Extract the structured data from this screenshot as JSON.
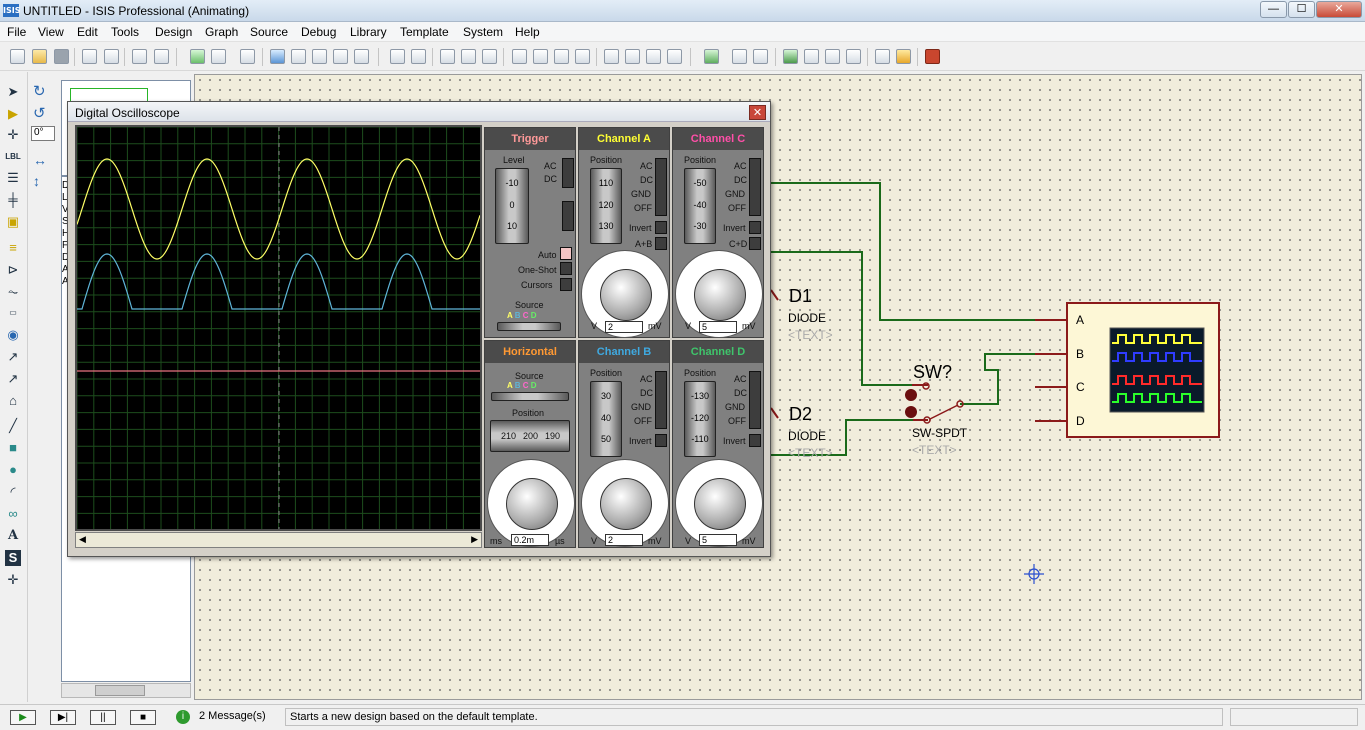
{
  "app": {
    "title": "UNTITLED - ISIS Professional (Animating)",
    "icon": "ISIS"
  },
  "window_controls": {
    "minimize": "—",
    "maximize": "☐",
    "close": "✕"
  },
  "menu": [
    "File",
    "View",
    "Edit",
    "Tools",
    "Design",
    "Graph",
    "Source",
    "Debug",
    "Library",
    "Template",
    "System",
    "Help"
  ],
  "left_panel": {
    "rotation": "0°",
    "list_letters": [
      "D",
      "L",
      "V",
      "S",
      "H",
      "F",
      "D",
      "A",
      "A"
    ]
  },
  "scope": {
    "title": "Digital Oscilloscope",
    "trigger": {
      "header": "Trigger",
      "level_label": "Level",
      "scale": [
        "-10",
        "0",
        "10"
      ],
      "coupling": [
        "AC",
        "DC"
      ],
      "modes": [
        "Auto",
        "One-Shot",
        "Cursors"
      ],
      "source_label": "Source",
      "sources": [
        "A",
        "B",
        "C",
        "D"
      ]
    },
    "channel_a": {
      "header": "Channel A",
      "position_label": "Position",
      "scale": [
        "110",
        "120",
        "130"
      ],
      "coupling": [
        "AC",
        "DC",
        "GND",
        "OFF"
      ],
      "invert": "Invert",
      "combine": "A+B",
      "knob_value": "2",
      "unit_left": "V",
      "unit_right": "mV",
      "knob_ticks": [
        "0.1",
        "0.2",
        "0.5",
        "1",
        "2",
        "5",
        "10",
        "20",
        "50"
      ]
    },
    "channel_c": {
      "header": "Channel C",
      "position_label": "Position",
      "scale": [
        "-50",
        "-40",
        "-30"
      ],
      "coupling": [
        "AC",
        "DC",
        "GND",
        "OFF"
      ],
      "invert": "Invert",
      "combine": "C+D",
      "knob_value": "5",
      "unit_left": "V",
      "unit_right": "mV"
    },
    "horizontal": {
      "header": "Horizontal",
      "source_label": "Source",
      "sources": [
        "A",
        "B",
        "C",
        "D"
      ],
      "position_label": "Position",
      "scale": [
        "210",
        "200",
        "190"
      ],
      "knob_value": "0.2m",
      "unit_left": "ms",
      "unit_right": "µs"
    },
    "channel_b": {
      "header": "Channel B",
      "position_label": "Position",
      "scale": [
        "30",
        "40",
        "50"
      ],
      "coupling": [
        "AC",
        "DC",
        "GND",
        "OFF"
      ],
      "invert": "Invert",
      "knob_value": "2",
      "unit_left": "V",
      "unit_right": "mV"
    },
    "channel_d": {
      "header": "Channel D",
      "position_label": "Position",
      "scale": [
        "-130",
        "-120",
        "-110"
      ],
      "coupling": [
        "AC",
        "DC",
        "GND",
        "OFF"
      ],
      "invert": "Invert",
      "knob_value": "5",
      "unit_left": "V",
      "unit_right": "mV"
    },
    "colors": {
      "trace_a": "#ffff66",
      "trace_b": "#5fb5d8",
      "trace_c": "#e8737f",
      "grid": "#1d4d1d"
    }
  },
  "schematic": {
    "d1": {
      "ref": "D1",
      "type": "DIODE",
      "text": "<TEXT>"
    },
    "d2": {
      "ref": "D2",
      "type": "DIODE",
      "text": "<TEXT>"
    },
    "sw": {
      "ref": "SW?",
      "type": "SW-SPDT",
      "text": "<TEXT>"
    },
    "scope_pins": [
      "A",
      "B",
      "C",
      "D"
    ]
  },
  "status": {
    "messages": "2 Message(s)",
    "text": "Starts a new design based on the default template."
  }
}
